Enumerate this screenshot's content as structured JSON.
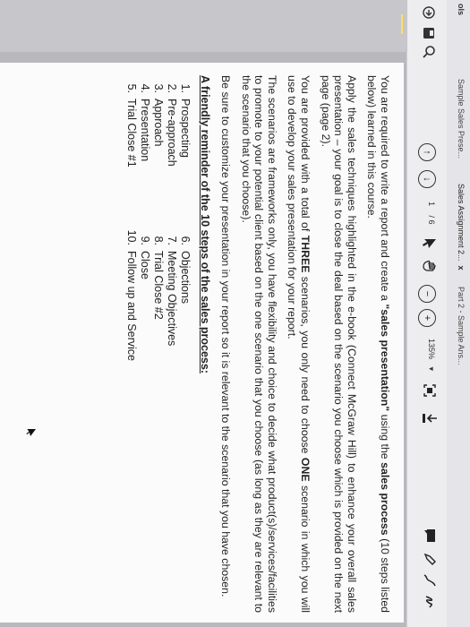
{
  "tabs": [
    {
      "label": "Sample Sales Prese..."
    },
    {
      "label": "Sales Assignment 2...",
      "close": "x"
    },
    {
      "label": "Part 2 - Sample Ans..."
    }
  ],
  "sidebar": {
    "top_label": "ols"
  },
  "toolbar": {
    "page_current": "1",
    "page_total": "/ 6",
    "zoom": "135%"
  },
  "document": {
    "para1_a": "You are required to write a report and create a ",
    "para1_b": "\"sales presentation\"",
    "para1_c": " using the ",
    "para1_d": "sales process",
    "para1_e": " (10 steps listed below) learned in this course.",
    "para2": "Apply the sales techniques highlighted in the e-book (Connect McGraw Hill) to enhance your overall sales presentation – your goal is to close the deal based on the scenario you choose which is provided on the next page (page 2).",
    "para3_a": "You are provided with a total of ",
    "para3_b": "THREE",
    "para3_c": " scenarios, you only need to choose ",
    "para3_d": "ONE",
    "para3_e": " scenario in which you will use to develop your sales presentation for your report.",
    "para4": "The scenarios are frameworks only, you have flexibility and choice to decide what product(s)/services/facilities to promote to your potential client based on the one scenario that you choose (as long as they are relevant to the scenario that you choose).",
    "para5": "Be sure to customize your presentation in your report so it is relevant to the scenario that you have chosen.",
    "reminder": "A friendly reminder of the 10 steps of the sales process:",
    "steps_col1": [
      {
        "num": "1.",
        "label": "Prospecting"
      },
      {
        "num": "2.",
        "label": "Pre-approach"
      },
      {
        "num": "3.",
        "label": "Approach"
      },
      {
        "num": "4.",
        "label": "Presentation"
      },
      {
        "num": "5.",
        "label": "Trial Close #1"
      }
    ],
    "steps_col2": [
      {
        "num": "6.",
        "label": "Objections"
      },
      {
        "num": "7.",
        "label": "Meeting Objectives"
      },
      {
        "num": "8.",
        "label": "Trial Close #2"
      },
      {
        "num": "9.",
        "label": "Close"
      },
      {
        "num": "10.",
        "label": "Follow up and Service"
      }
    ]
  },
  "colors": {
    "toolbar_bg": "#ededf0",
    "sidebar_bg": "#c7c6cb",
    "page_bg": "#fbfbfb",
    "text": "#222222"
  }
}
